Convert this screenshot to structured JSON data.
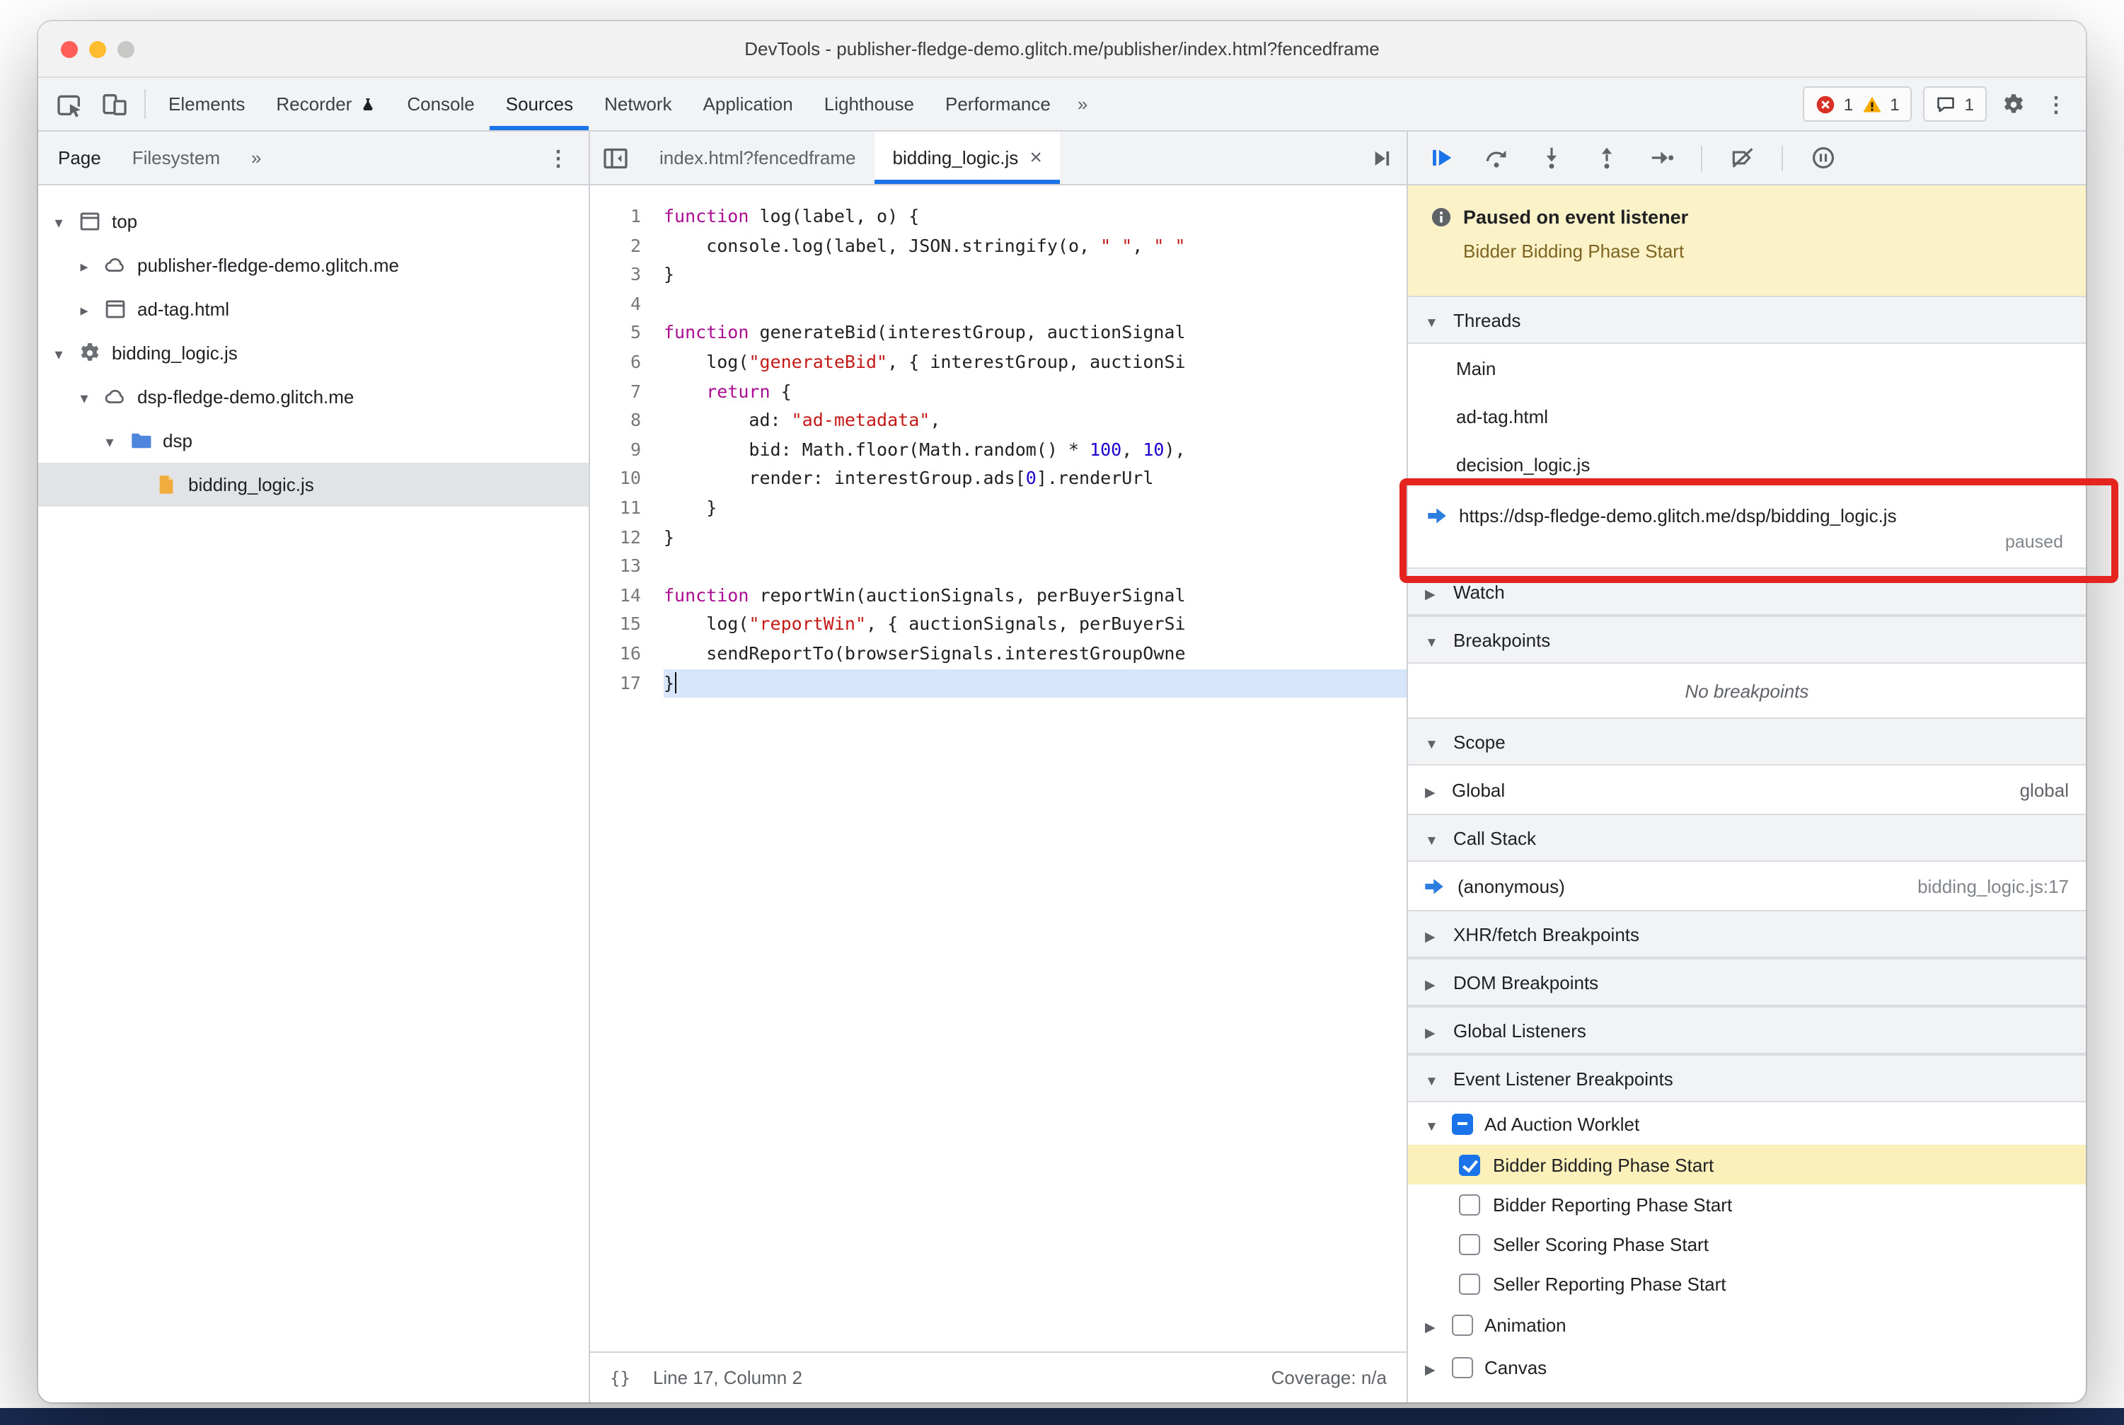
{
  "window": {
    "title": "DevTools - publisher-fledge-demo.glitch.me/publisher/index.html?fencedframe"
  },
  "glyphs": {
    "kebab": "⋮"
  },
  "colors": {
    "accent": "#1a73e8",
    "annotation_red": "#e52420",
    "paused_banner_bg": "#fcf2c8",
    "breakpoint_highlight": "#fbefba",
    "selection_blue": "#d7e6fa",
    "error_red": "#d93025",
    "warning_yellow": "#f9ab00",
    "keyword_purple": "#aa0d91",
    "string_red": "#c41a16",
    "number_blue": "#1c00cf",
    "folder_blue": "#4e86dd",
    "js_file_yellow": "#f0ad3e"
  },
  "toolbar": {
    "left_icons": [
      "inspect-icon",
      "device-toolbar-icon"
    ],
    "tabs": [
      "Elements",
      "Recorder",
      "Console",
      "Sources",
      "Network",
      "Application",
      "Lighthouse",
      "Performance"
    ],
    "active_tab": "Sources",
    "overflow": "»",
    "error_count": "1",
    "warning_count": "1",
    "issue_count": "1"
  },
  "navigator": {
    "tabs": {
      "page": "Page",
      "filesystem": "Filesystem",
      "overflow": "»"
    },
    "tree": [
      {
        "label": "top",
        "icon": "frame-icon",
        "arrow": "expanded",
        "depth": 0
      },
      {
        "label": "publisher-fledge-demo.glitch.me",
        "icon": "cloud-icon",
        "arrow": "collapsed",
        "depth": 1
      },
      {
        "label": "ad-tag.html",
        "icon": "frame-icon",
        "arrow": "collapsed",
        "depth": 1
      },
      {
        "label": "bidding_logic.js",
        "icon": "worklet-gear-icon",
        "arrow": "expanded",
        "depth": 0
      },
      {
        "label": "dsp-fledge-demo.glitch.me",
        "icon": "cloud-icon",
        "arrow": "expanded",
        "depth": 1
      },
      {
        "label": "dsp",
        "icon": "folder-icon",
        "arrow": "expanded",
        "depth": 2
      },
      {
        "label": "bidding_logic.js",
        "icon": "js-file-icon",
        "arrow": "none",
        "depth": 3,
        "selected": true
      }
    ]
  },
  "editor": {
    "tabs": [
      {
        "label": "index.html?fencedframe",
        "active": false
      },
      {
        "label": "bidding_logic.js",
        "active": true,
        "close": "×"
      }
    ],
    "status": {
      "format_icon": "{}",
      "line_col": "Line 17, Column 2",
      "coverage": "Coverage: n/a"
    },
    "code": [
      {
        "n": 1,
        "tokens": [
          [
            "kw",
            "function"
          ],
          [
            "pl",
            " log(label, o) {"
          ]
        ]
      },
      {
        "n": 2,
        "tokens": [
          [
            "pl",
            "    console.log(label, JSON.stringify(o, "
          ],
          [
            "str",
            "\" \""
          ],
          [
            "pl",
            ", "
          ],
          [
            "str",
            "\" \""
          ]
        ]
      },
      {
        "n": 3,
        "tokens": [
          [
            "pl",
            "}"
          ]
        ]
      },
      {
        "n": 4,
        "tokens": []
      },
      {
        "n": 5,
        "tokens": [
          [
            "kw",
            "function"
          ],
          [
            "pl",
            " generateBid(interestGroup, auctionSignal"
          ]
        ]
      },
      {
        "n": 6,
        "tokens": [
          [
            "pl",
            "    log("
          ],
          [
            "str",
            "\"generateBid\""
          ],
          [
            "pl",
            ", { interestGroup, auctionSi"
          ]
        ]
      },
      {
        "n": 7,
        "tokens": [
          [
            "pl",
            "    "
          ],
          [
            "kw",
            "return"
          ],
          [
            "pl",
            " {"
          ]
        ]
      },
      {
        "n": 8,
        "tokens": [
          [
            "pl",
            "        ad: "
          ],
          [
            "str",
            "\"ad-metadata\""
          ],
          [
            "pl",
            ","
          ]
        ]
      },
      {
        "n": 9,
        "tokens": [
          [
            "pl",
            "        bid: Math.floor(Math.random() * "
          ],
          [
            "num",
            "100"
          ],
          [
            "pl",
            ", "
          ],
          [
            "num",
            "10"
          ],
          [
            "pl",
            "),"
          ]
        ]
      },
      {
        "n": 10,
        "tokens": [
          [
            "pl",
            "        render: interestGroup.ads["
          ],
          [
            "num",
            "0"
          ],
          [
            "pl",
            "].renderUrl"
          ]
        ]
      },
      {
        "n": 11,
        "tokens": [
          [
            "pl",
            "    }"
          ]
        ]
      },
      {
        "n": 12,
        "tokens": [
          [
            "pl",
            "}"
          ]
        ]
      },
      {
        "n": 13,
        "tokens": []
      },
      {
        "n": 14,
        "tokens": [
          [
            "kw",
            "function"
          ],
          [
            "pl",
            " reportWin(auctionSignals, perBuyerSignal"
          ]
        ]
      },
      {
        "n": 15,
        "tokens": [
          [
            "pl",
            "    log("
          ],
          [
            "str",
            "\"reportWin\""
          ],
          [
            "pl",
            ", { auctionSignals, perBuyerSi"
          ]
        ]
      },
      {
        "n": 16,
        "tokens": [
          [
            "pl",
            "    sendReportTo(browserSignals.interestGroupOwne"
          ]
        ]
      },
      {
        "n": 17,
        "tokens": [
          [
            "pl",
            "}"
          ]
        ],
        "selected": true,
        "caret": true
      }
    ]
  },
  "debugger": {
    "toolbar_icons": [
      "resume-icon",
      "step-over-icon",
      "step-into-icon",
      "step-out-icon",
      "step-icon",
      "|",
      "deactivate-breakpoints-icon",
      "|",
      "pause-on-exceptions-icon"
    ],
    "banner": {
      "title": "Paused on event listener",
      "detail": "Bidder Bidding Phase Start"
    },
    "threads": {
      "label": "Threads",
      "items": [
        {
          "label": "Main"
        },
        {
          "label": "ad-tag.html"
        },
        {
          "label": "decision_logic.js"
        },
        {
          "label": "https://dsp-fledge-demo.glitch.me/dsp/bidding_logic.js",
          "active": true,
          "status": "paused"
        }
      ]
    },
    "watch": {
      "label": "Watch"
    },
    "breakpoints": {
      "label": "Breakpoints",
      "empty_text": "No breakpoints"
    },
    "scope": {
      "label": "Scope",
      "items": [
        {
          "label": "Global",
          "value": "global"
        }
      ]
    },
    "call_stack": {
      "label": "Call Stack",
      "items": [
        {
          "label": "(anonymous)",
          "location": "bidding_logic.js:17",
          "active": true
        }
      ]
    },
    "xhr_breakpoints": {
      "label": "XHR/fetch Breakpoints"
    },
    "dom_breakpoints": {
      "label": "DOM Breakpoints"
    },
    "global_listeners": {
      "label": "Global Listeners"
    },
    "event_listener_breakpoints": {
      "label": "Event Listener Breakpoints",
      "groups": [
        {
          "label": "Ad Auction Worklet",
          "arrow": "expanded",
          "checkbox": "indeterminate",
          "children": [
            {
              "label": "Bidder Bidding Phase Start",
              "checked": true,
              "highlighted": true
            },
            {
              "label": "Bidder Reporting Phase Start",
              "checked": false
            },
            {
              "label": "Seller Scoring Phase Start",
              "checked": false
            },
            {
              "label": "Seller Reporting Phase Start",
              "checked": false
            }
          ]
        },
        {
          "label": "Animation",
          "arrow": "collapsed",
          "checkbox": "unchecked",
          "children": []
        },
        {
          "label": "Canvas",
          "arrow": "collapsed",
          "checkbox": "unchecked",
          "children": []
        }
      ]
    }
  }
}
